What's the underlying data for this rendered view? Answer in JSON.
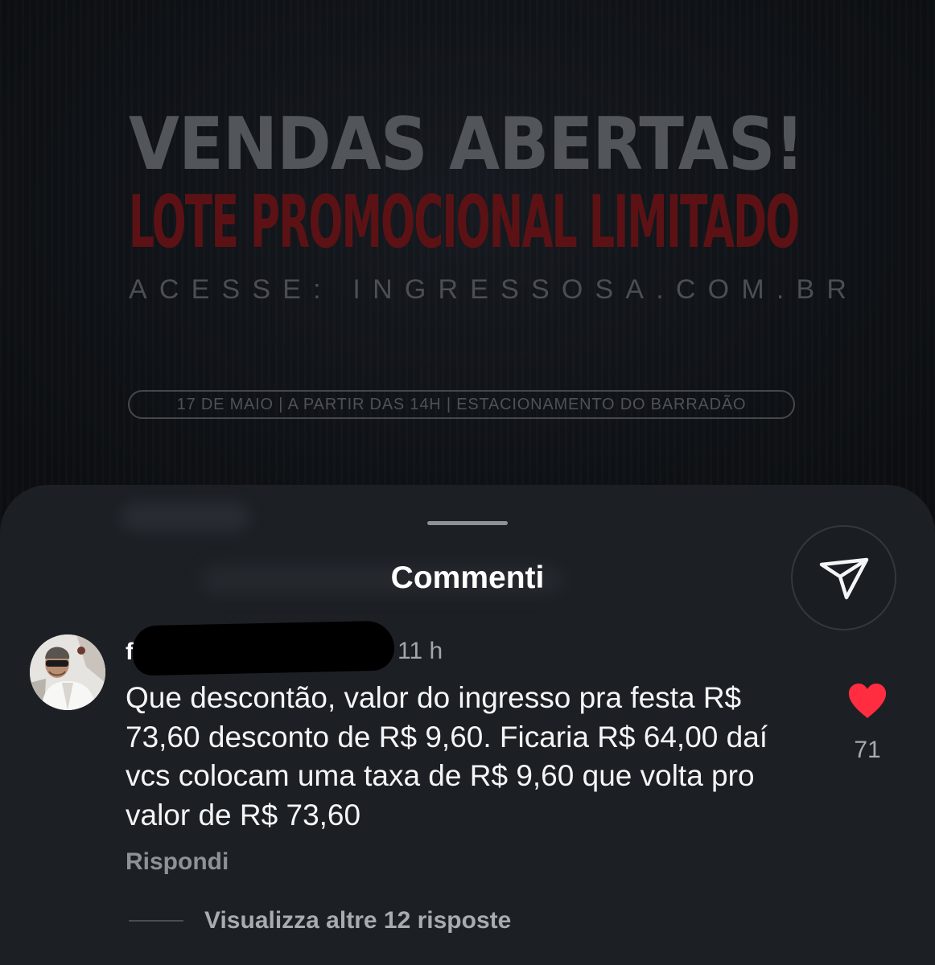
{
  "post_image": {
    "headline": "VENDAS ABERTAS!",
    "subheadline": "LOTE PROMOCIONAL LIMITADO",
    "url_line": "ACESSE: INGRESSOSA.COM.BR",
    "event_info": "17 DE MAIO | A PARTIR DAS 14H | ESTACIONAMENTO DO BARRADÃO"
  },
  "sheet": {
    "title": "Commenti",
    "share_icon": "paper-plane-icon"
  },
  "comment": {
    "username_visible": "f",
    "time": "11 h",
    "text": "Que descontão, valor do ingresso pra festa R$ 73,60 desconto de R$ 9,60. Ficaria R$ 64,00 daí vcs colocam uma taxa de R$ 9,60 que volta pro valor de R$ 73,60",
    "reply_label": "Rispondi",
    "like_icon": "heart-icon",
    "like_count": "71",
    "view_replies_label": "Visualizza altre 12 risposte"
  },
  "colors": {
    "sheet_bg": "#1c1f24",
    "headline": "#52565b",
    "subheadline": "#5c1214",
    "like_red": "#ff2d3f"
  }
}
